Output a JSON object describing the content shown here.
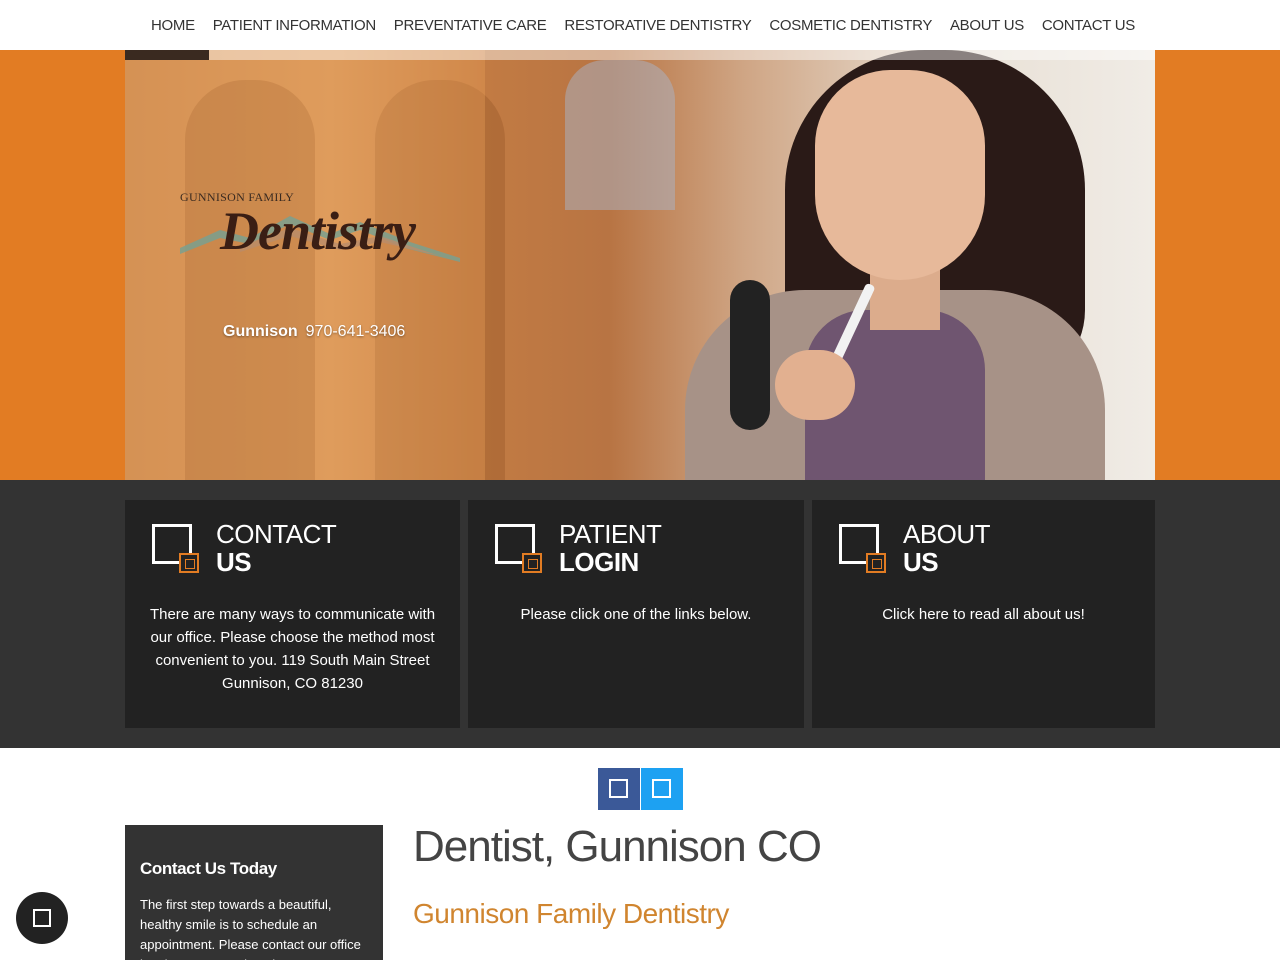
{
  "nav": {
    "items": [
      {
        "label": "HOME"
      },
      {
        "label": "PATIENT INFORMATION"
      },
      {
        "label": "PREVENTATIVE CARE"
      },
      {
        "label": "RESTORATIVE DENTISTRY"
      },
      {
        "label": "COSMETIC DENTISTRY"
      },
      {
        "label": "ABOUT US"
      },
      {
        "label": "CONTACT US"
      }
    ]
  },
  "hero": {
    "logo_small": "GUNNISON FAMILY",
    "logo_big": "Dentistry",
    "city": "Gunnison",
    "phone": "970-641-3406"
  },
  "cards": [
    {
      "title_1": "CONTACT",
      "title_2": "US",
      "text": "There are many ways to communicate with our office. Please choose the method most convenient to you. 119 South Main Street Gunnison, CO 81230"
    },
    {
      "title_1": "PATIENT",
      "title_2": "LOGIN",
      "text": "Please click one of the links below."
    },
    {
      "title_1": "ABOUT",
      "title_2": "US",
      "text": "Click here to read all about us!"
    }
  ],
  "social": {
    "icons": [
      "facebook-icon",
      "twitter-icon"
    ],
    "facebook_color": "#3b5998",
    "twitter_color": "#1da1f2"
  },
  "sidebar": {
    "heading": "Contact Us Today",
    "text": "The first step towards a beautiful, healthy smile is to schedule an appointment. Please contact our office by phone or complete the"
  },
  "main": {
    "title": "Dentist, Gunnison CO",
    "subtitle": "Gunnison Family Dentistry"
  },
  "colors": {
    "accent": "#e27c23",
    "dark_band": "#333333",
    "card_bg": "#222222"
  }
}
